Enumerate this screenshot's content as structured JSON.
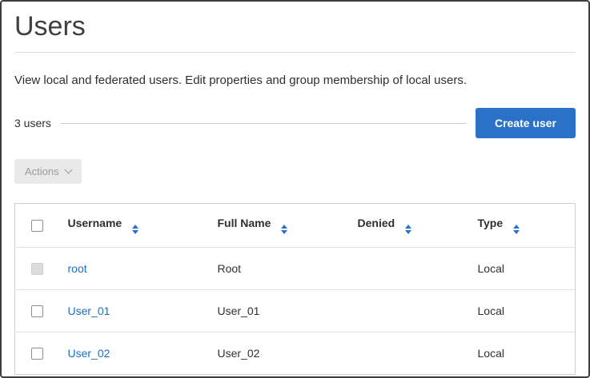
{
  "page": {
    "title": "Users",
    "description": "View local and federated users. Edit properties and group membership of local users."
  },
  "toolbar": {
    "count_label": "3 users",
    "create_button_label": "Create user",
    "actions_button_label": "Actions"
  },
  "colors": {
    "accent_blue": "#2a72c8",
    "link_blue": "#1c6fc4"
  },
  "table": {
    "columns": [
      "Username",
      "Full Name",
      "Denied",
      "Type"
    ],
    "rows": [
      {
        "username": "root",
        "full_name": "Root",
        "denied": "",
        "type": "Local"
      },
      {
        "username": "User_01",
        "full_name": "User_01",
        "denied": "",
        "type": "Local"
      },
      {
        "username": "User_02",
        "full_name": "User_02",
        "denied": "",
        "type": "Local"
      }
    ]
  }
}
